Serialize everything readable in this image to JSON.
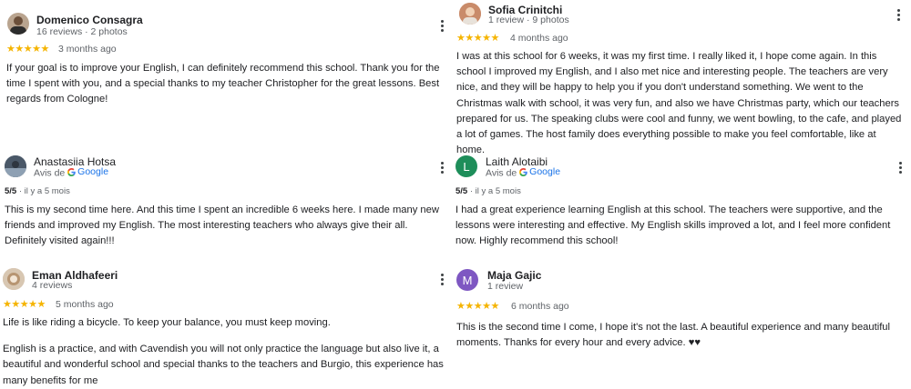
{
  "reviews": [
    {
      "name": "Domenico Consagra",
      "meta": "16 reviews · 2 photos",
      "stars": "★★★★★",
      "age": "3 months ago",
      "text": "If your goal is to improve your English, I can definitely recommend this school. Thank you for the time I spent with you, and a special thanks to my teacher Christopher for the great lessons. Best regards from Cologne!"
    },
    {
      "name": "Sofia Crinitchi",
      "meta": "1 review · 9 photos",
      "stars": "★★★★★",
      "age": "4 months ago",
      "text": "I was at this school for 6 weeks, it was my first time. I really liked it, I hope come again. In this school I improved my English, and I also met nice and interesting people. The teachers are very nice, and they will be happy to help you if you don't understand something. We went to the Christmas walk with school, it was very fun, and also we have Christmas party, which our teachers prepared for us. The speaking clubs were cool and funny, we went bowling, to the cafe, and played a lot of games. The host family does everything possible to make you feel comfortable, like at home."
    },
    {
      "name": "Anastasiia Hotsa",
      "meta_prefix": "Avis de",
      "meta_source": "Google",
      "score": "5/5",
      "score_age": " · il y a 5 mois",
      "text": "This is my second time here. And this time I spent an incredible 6 weeks here. I made many new friends and improved my English. The most interesting teachers who always give their all. Definitely visited again!!!"
    },
    {
      "name": "Laith Alotaibi",
      "initial": "L",
      "meta_prefix": "Avis de",
      "meta_source": "Google",
      "score": "5/5",
      "score_age": " · il y a 5 mois",
      "text": "I had a great experience learning English at this school. The teachers were supportive, and the lessons were interesting and effective. My English skills improved a lot, and I feel more confident now. Highly recommend this school!"
    },
    {
      "name": "Eman Aldhafeeri",
      "meta": "4 reviews",
      "stars": "★★★★★",
      "age": "5 months ago",
      "text_p1": "Life is like riding a bicycle. To keep your balance, you must keep moving.",
      "text_p2": "English is a practice, and with Cavendish you will not only practice the language but also live it, a beautiful and wonderful school and special thanks to the teachers and Burgio, this experience has many benefits for me"
    },
    {
      "name": "Maja Gajic",
      "initial": "M",
      "meta": "1 review",
      "stars": "★★★★★",
      "age": "6 months ago",
      "text": "This is the second time I come, I hope it's not the last. A beautiful experience and many beautiful moments. Thanks for every hour and every advice. ♥♥"
    }
  ],
  "colors": {
    "star": "#f5b400",
    "google_link": "#1a73e8",
    "avatar_laith": "#1e8e5a",
    "avatar_maja": "#7e57c2"
  }
}
